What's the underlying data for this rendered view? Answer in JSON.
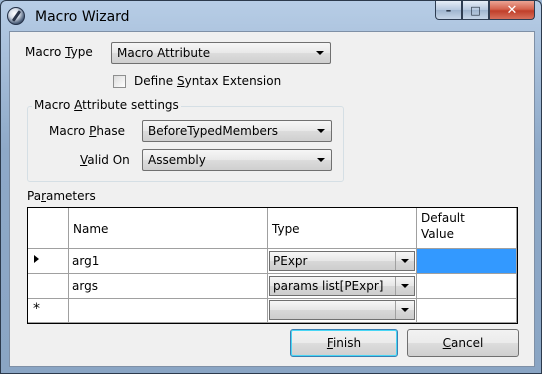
{
  "window": {
    "title": "Macro Wizard",
    "minimize_glyph": "–",
    "maximize_glyph": "□",
    "close_glyph": "✕"
  },
  "macro_type": {
    "label_pre": "Macro ",
    "label_hot": "T",
    "label_post": "ype",
    "value": "Macro Attribute"
  },
  "syntax_extension": {
    "label_pre": "Define ",
    "label_hot": "S",
    "label_post": "yntax Extension",
    "checked": false
  },
  "attribute_settings": {
    "title_pre": "Macro ",
    "title_hot": "A",
    "title_post": "ttribute settings",
    "phase_label_pre": "Macro ",
    "phase_label_hot": "P",
    "phase_label_post": "hase",
    "phase_value": "BeforeTypedMembers",
    "valid_on_label_pre": "",
    "valid_on_label_hot": "V",
    "valid_on_label_post": "alid On",
    "valid_on_value": "Assembly"
  },
  "parameters": {
    "title_pre": "Pa",
    "title_hot": "r",
    "title_post": "ameters",
    "columns": {
      "name": "Name",
      "type": "Type",
      "default": "Default Value"
    },
    "rows": [
      {
        "name": "arg1",
        "type": "PExpr",
        "default": ""
      },
      {
        "name": "args",
        "type": "params list[PExpr]",
        "default": ""
      }
    ],
    "new_row_marker": "*",
    "selected_cell_color": "#3399ff"
  },
  "buttons": {
    "finish_hot": "F",
    "finish_post": "inish",
    "cancel_hot": "C",
    "cancel_post": "ancel"
  }
}
